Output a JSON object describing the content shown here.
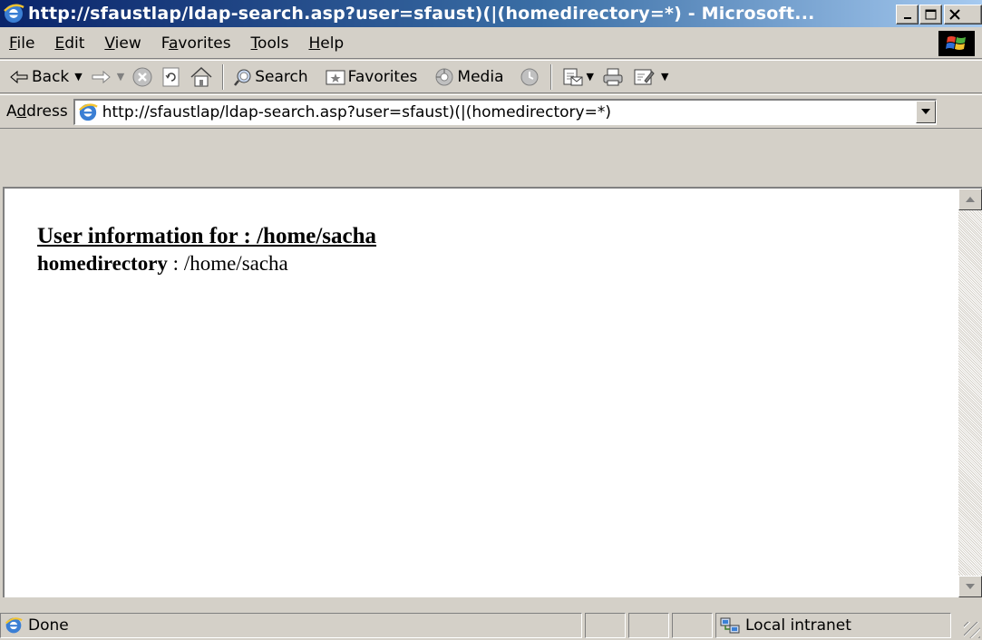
{
  "window": {
    "title": "http://sfaustlap/ldap-search.asp?user=sfaust)(|(homedirectory=*) - Microsoft..."
  },
  "menu": [
    "File",
    "Edit",
    "View",
    "Favorites",
    "Tools",
    "Help"
  ],
  "toolbar": {
    "back_label": "Back",
    "search_label": "Search",
    "favorites_label": "Favorites",
    "media_label": "Media"
  },
  "address": {
    "label": "Address",
    "url": "http://sfaustlap/ldap-search.asp?user=sfaust)(|(homedirectory=*)"
  },
  "page": {
    "heading": "User information for : /home/sacha",
    "field_name": "homedirectory",
    "field_separator": " : ",
    "field_value": "/home/sacha"
  },
  "status": {
    "text": "Done",
    "zone": "Local intranet"
  },
  "icons": {
    "ie": "internet-explorer-icon",
    "stop": "stop-icon",
    "refresh": "refresh-icon",
    "home": "home-icon",
    "search": "search-icon",
    "favorites": "favorites-icon",
    "media": "media-icon",
    "history": "history-icon",
    "mail": "mail-icon",
    "print": "print-icon",
    "edit": "edit-icon"
  },
  "colors": {
    "titlebar_start": "#0a246a",
    "titlebar_end": "#a6caf0",
    "chrome": "#d4d0c8"
  }
}
